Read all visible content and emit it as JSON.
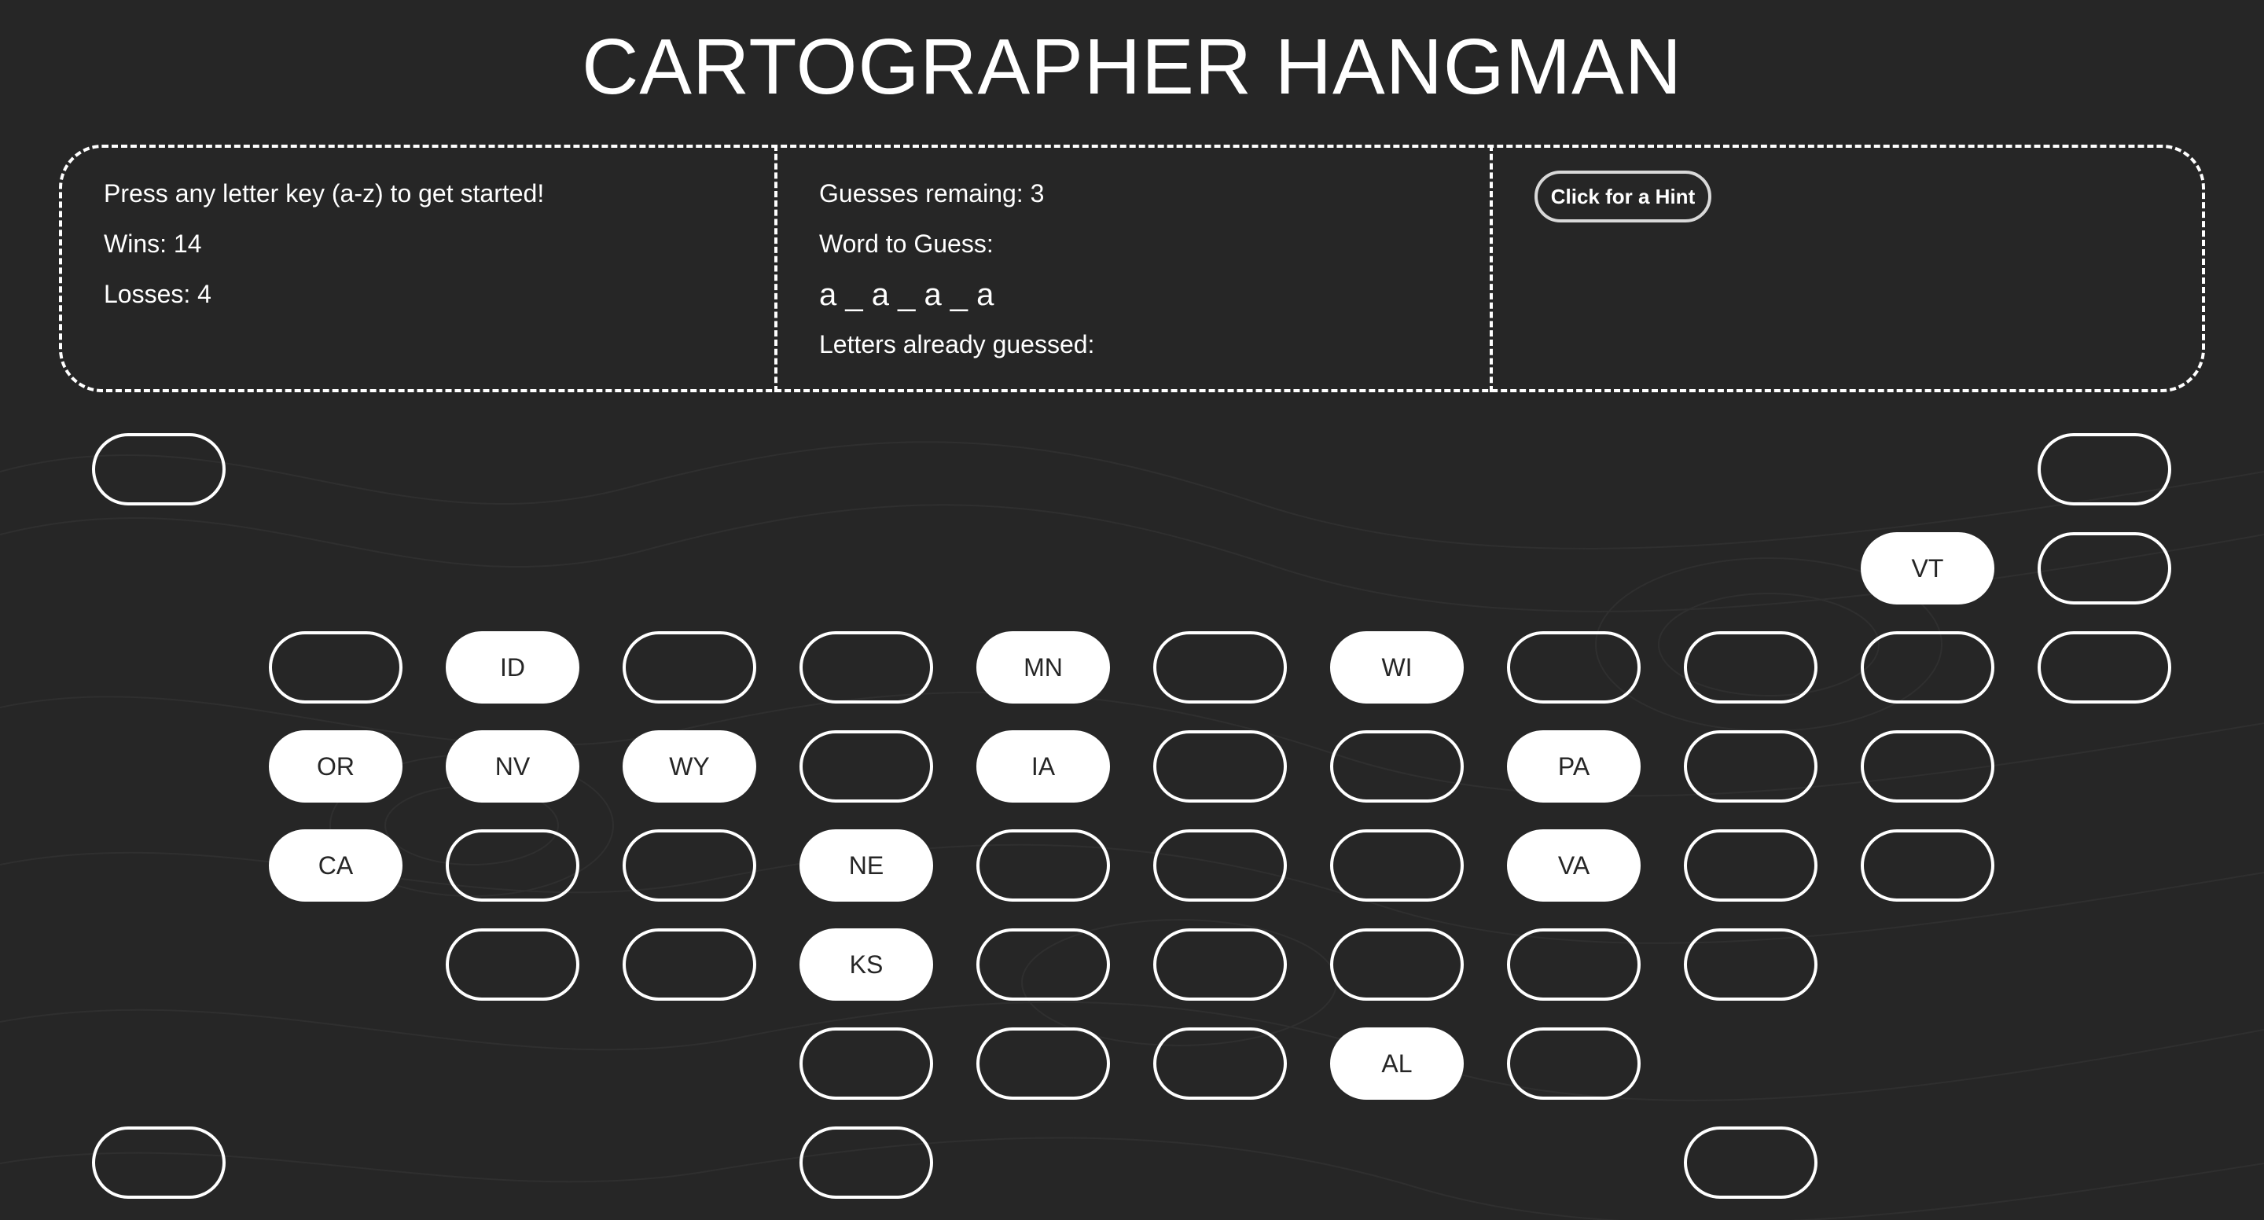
{
  "title": "CARTOGRAPHER HANGMAN",
  "status": {
    "prompt": "Press any letter key (a-z) to get started!",
    "wins_label": "Wins: 14",
    "losses_label": "Losses: 4"
  },
  "game": {
    "guesses_label": "Guesses remaing: 3",
    "word_label": "Word to Guess:",
    "word_display": "a _ a _ a _ a",
    "guessed_label": "Letters already guessed:"
  },
  "hint": {
    "button_label": "Click for a Hint"
  },
  "colors": {
    "background": "#262626",
    "foreground": "#ffffff"
  },
  "map": {
    "grid": [
      [
        "",
        null,
        null,
        null,
        null,
        null,
        null,
        null,
        null,
        null,
        null,
        ""
      ],
      [
        null,
        null,
        null,
        null,
        null,
        null,
        null,
        null,
        null,
        null,
        "VT",
        ""
      ],
      [
        null,
        "",
        "ID",
        "",
        "",
        "MN",
        "",
        "WI",
        "",
        "",
        "",
        ""
      ],
      [
        null,
        "OR",
        "NV",
        "WY",
        "",
        "IA",
        "",
        "",
        "PA",
        "",
        "",
        null
      ],
      [
        null,
        "CA",
        "",
        "",
        "NE",
        "",
        "",
        "",
        "VA",
        "",
        "",
        null
      ],
      [
        null,
        null,
        "",
        "",
        "KS",
        "",
        "",
        "",
        "",
        "",
        null,
        null
      ],
      [
        null,
        null,
        null,
        null,
        "",
        "",
        "",
        "AL",
        "",
        null,
        null,
        null
      ],
      [
        "",
        null,
        null,
        null,
        "",
        null,
        null,
        null,
        null,
        "",
        null,
        null
      ]
    ]
  }
}
